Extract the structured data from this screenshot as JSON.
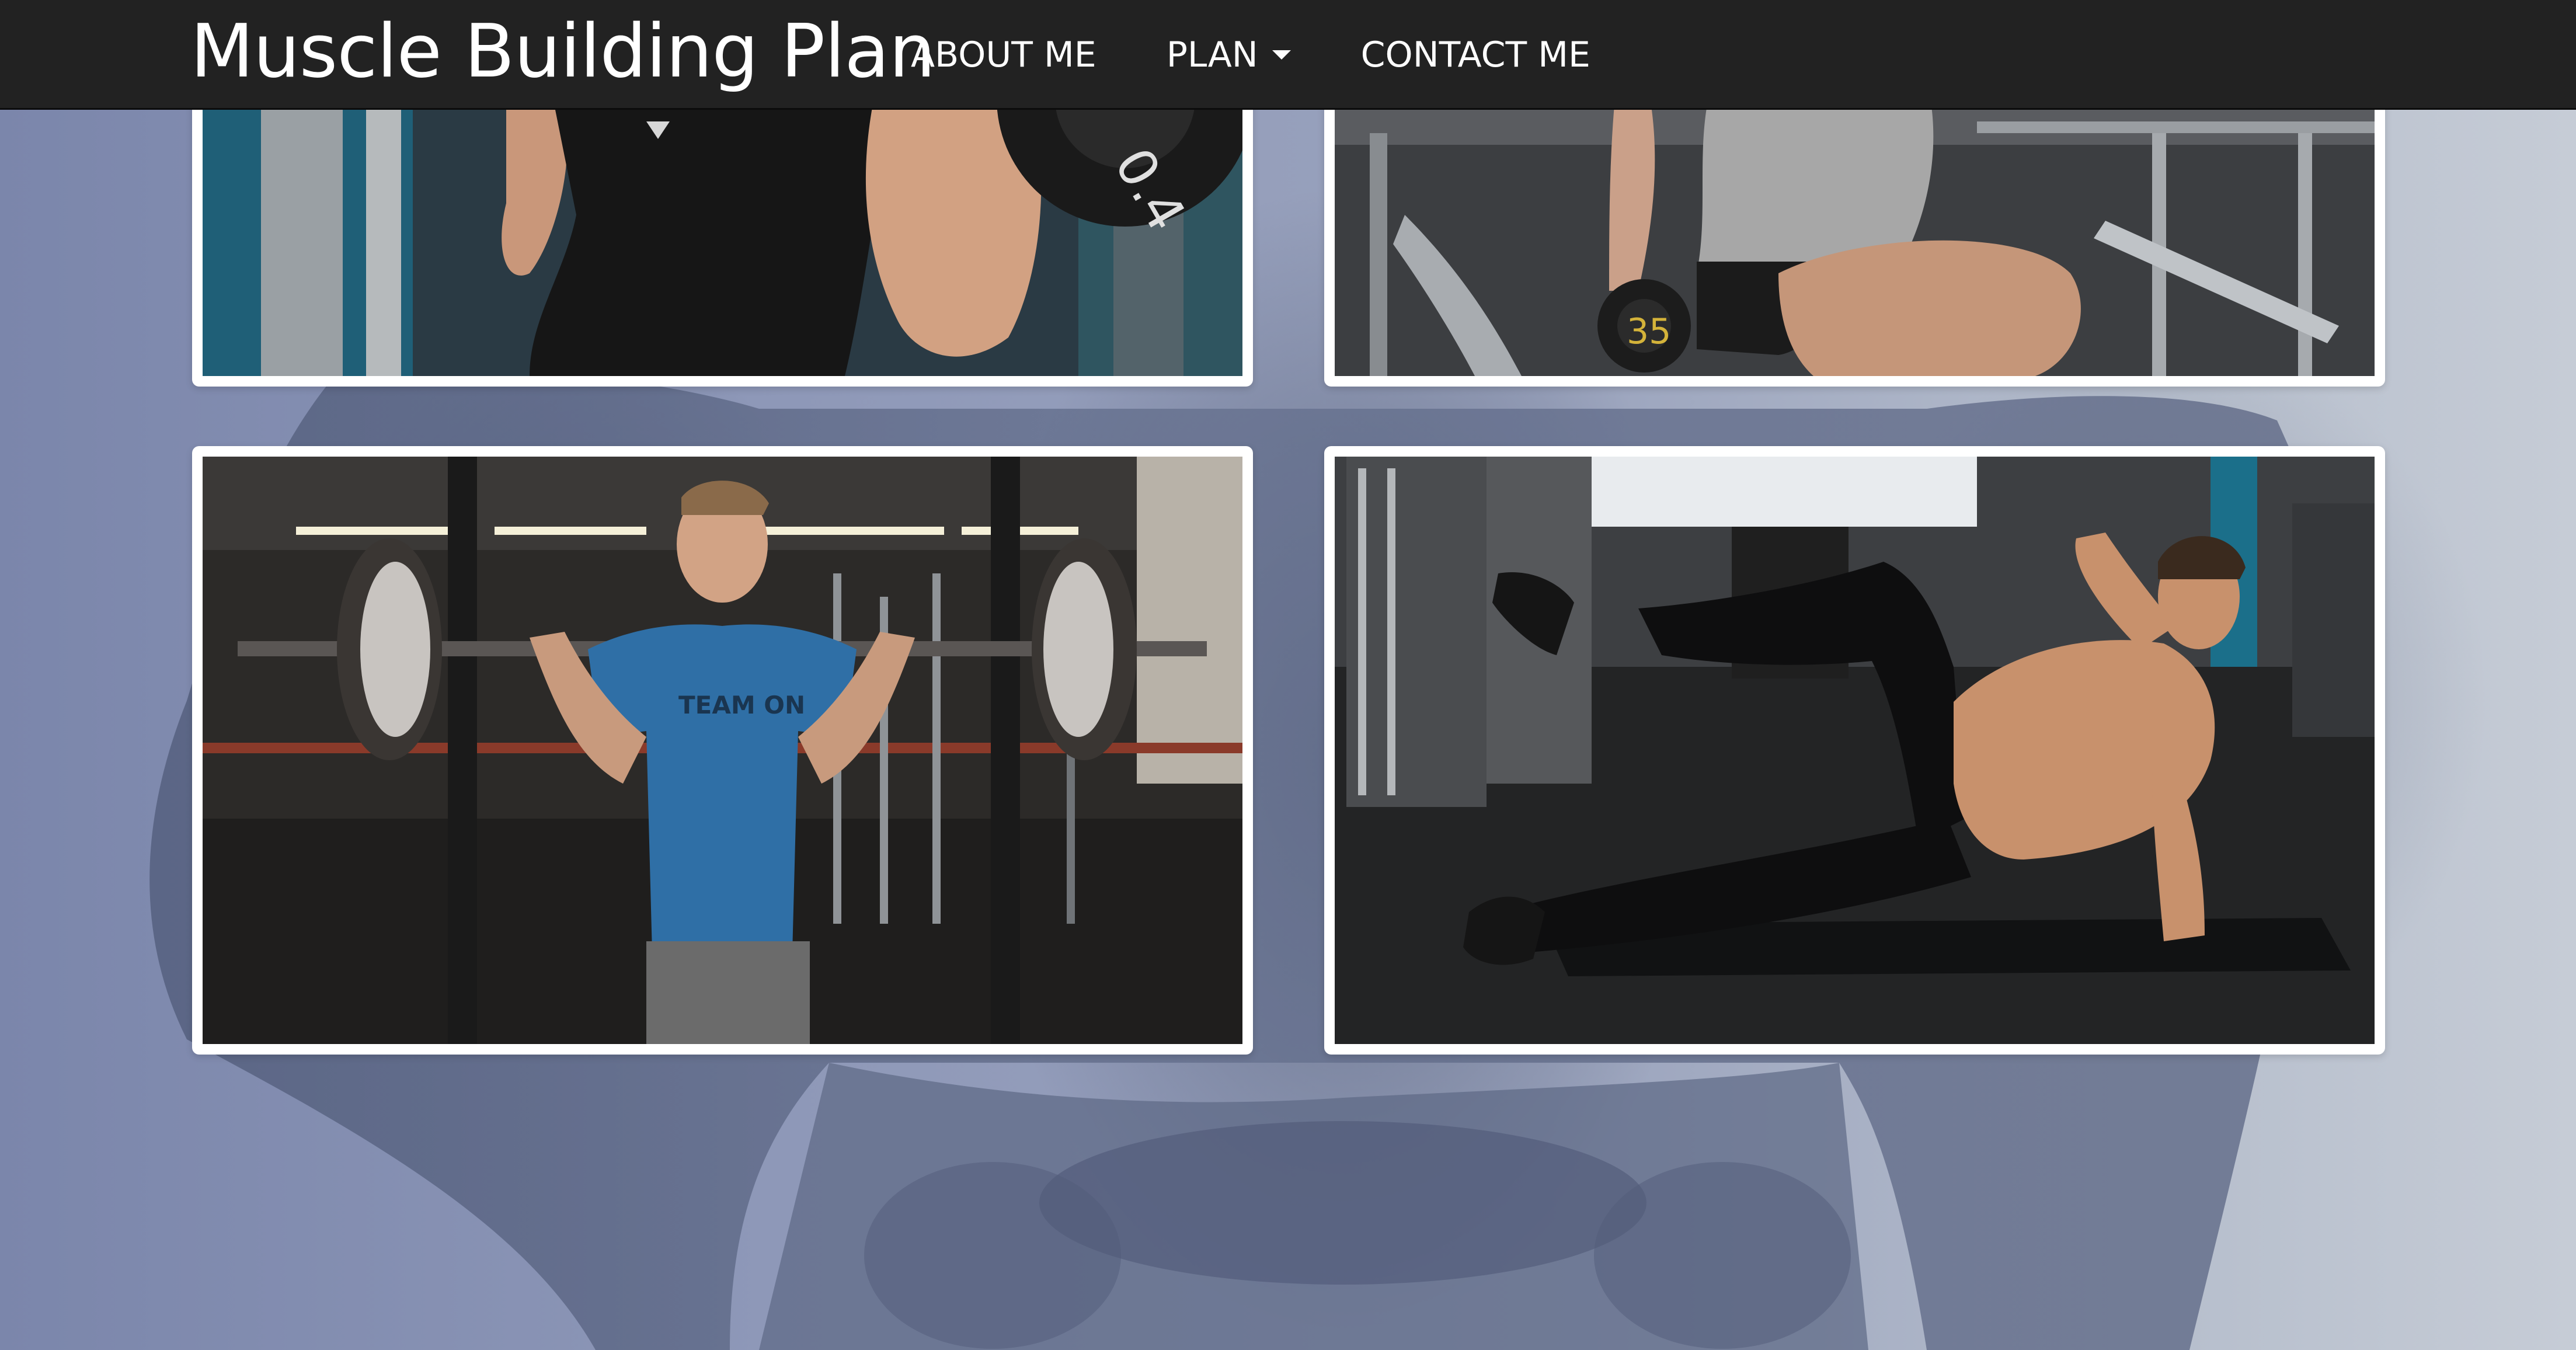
{
  "navbar": {
    "brand": "Muscle Building Plan",
    "links": [
      {
        "label": "ABOUT ME",
        "dropdown": false
      },
      {
        "label": "PLAN",
        "dropdown": true
      },
      {
        "label": "CONTACT ME",
        "dropdown": false
      }
    ]
  },
  "gallery": {
    "images": [
      {
        "subject": "man-barbell-curl-black-tank-top"
      },
      {
        "subject": "man-seated-dumbbell-curl"
      },
      {
        "subject": "man-barbell-squat-rack-blue-shirt"
      },
      {
        "subject": "man-side-plank-leg-raise-on-mat"
      }
    ],
    "shirt_text": "TEAM ON",
    "plate_text": "0.4",
    "dumbbell_text": "35"
  },
  "colors": {
    "navbar": "#222222",
    "nav_text": "#ffffff",
    "card_border": "#ffffff",
    "background": "#8e98b8"
  }
}
